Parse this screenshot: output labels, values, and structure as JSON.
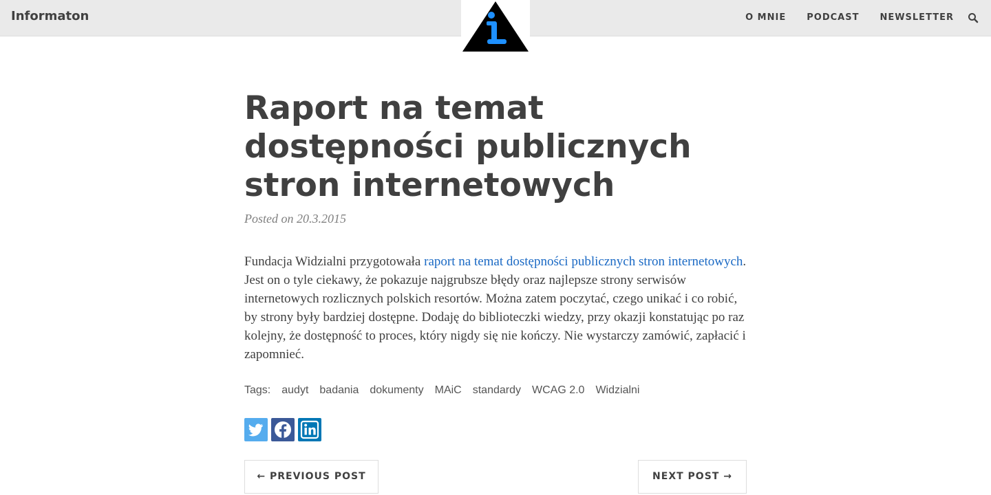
{
  "header": {
    "brand": "Informaton",
    "logo_icon": "info-triangle-icon",
    "nav": [
      "O MNIE",
      "PODCAST",
      "NEWSLETTER"
    ],
    "search_icon": "search-icon"
  },
  "post": {
    "title": "Raport na temat dostępności publicznych stron internetowych",
    "meta": "Posted on 20.3.2015",
    "body_intro": "Fundacja Widzialni przygotowała ",
    "body_link": "raport na temat dostępności publicznych stron internetowych",
    "body_rest": ". Jest on o tyle ciekawy, że pokazuje najgrubsze błędy oraz najlepsze strony serwisów internetowych rozlicznych polskich resortów. Można zatem poczytać, czego unikać i co robić, by strony były bardziej dostępne. Dodaję do biblioteczki wiedzy, przy okazji konstatując po raz kolejny, że dostępność to proces, który nigdy się nie kończy. Nie wystarczy zamówić, zapłacić i zapomnieć.",
    "tags_label": "Tags:",
    "tags": [
      "audyt",
      "badania",
      "dokumenty",
      "MAiC",
      "standardy",
      "WCAG 2.0",
      "Widzialni"
    ],
    "share_icons": [
      "twitter-icon",
      "facebook-icon",
      "linkedin-icon"
    ]
  },
  "pager": {
    "prev_label": "← PREVIOUS POST",
    "next_label": "NEXT POST →"
  },
  "colors": {
    "header_bg": "#eaeaea",
    "link": "#1a69c4",
    "logo_i": "#1e90ff",
    "twitter": "#55acee",
    "facebook": "#3b5998",
    "linkedin": "#0077b5"
  }
}
